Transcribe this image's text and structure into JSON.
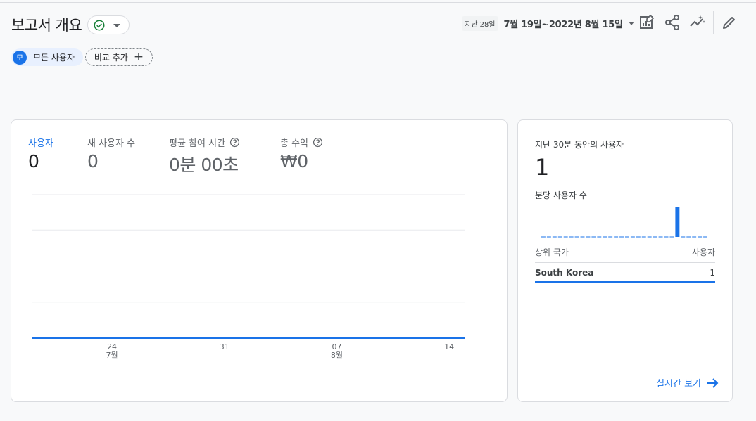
{
  "header": {
    "title": "보고서 개요",
    "status": "check-circle-icon",
    "date_chip": "지난 28일",
    "date_range": "7월 19일~2022년 8월 15일"
  },
  "toolbar": {
    "icons": [
      "customize-report-icon",
      "share-icon",
      "insights-icon",
      "edit-icon"
    ]
  },
  "comparison": {
    "segment_letter": "모",
    "segment_label": "모든 사용자",
    "add_label": "비교 추가"
  },
  "metrics": [
    {
      "label": "사용자",
      "value": "0",
      "active": true
    },
    {
      "label": "새 사용자 수",
      "value": "0"
    },
    {
      "label": "평균 참여 시간",
      "value": "0분 00초",
      "help": true
    },
    {
      "label": "총 수익",
      "value": "₩0",
      "help": true
    }
  ],
  "chart_data": {
    "type": "line",
    "x": [
      "2022-07-19",
      "2022-07-20",
      "2022-07-21",
      "2022-07-22",
      "2022-07-23",
      "2022-07-24",
      "2022-07-25",
      "2022-07-26",
      "2022-07-27",
      "2022-07-28",
      "2022-07-29",
      "2022-07-30",
      "2022-07-31",
      "2022-08-01",
      "2022-08-02",
      "2022-08-03",
      "2022-08-04",
      "2022-08-05",
      "2022-08-06",
      "2022-08-07",
      "2022-08-08",
      "2022-08-09",
      "2022-08-10",
      "2022-08-11",
      "2022-08-12",
      "2022-08-13",
      "2022-08-14",
      "2022-08-15"
    ],
    "series": [
      {
        "values": [
          0,
          0,
          0,
          0,
          0,
          0,
          0,
          0,
          0,
          0,
          0,
          0,
          0,
          0,
          0,
          0,
          0,
          0,
          0,
          0,
          0,
          0,
          0,
          0,
          0,
          0,
          0,
          0
        ]
      }
    ],
    "tick_labels": [
      {
        "x": "2022-07-24",
        "day": "24",
        "month": "7월"
      },
      {
        "x": "2022-07-31",
        "day": "31",
        "month": ""
      },
      {
        "x": "2022-08-07",
        "day": "07",
        "month": "8월"
      },
      {
        "x": "2022-08-14",
        "day": "14",
        "month": ""
      }
    ],
    "grid": true,
    "line_color": "#1a73e8"
  },
  "realtime": {
    "title": "지난 30분 동안의 사용자",
    "value": "1",
    "subtitle": "분당 사용자 수",
    "per_minute": [
      0,
      0,
      0,
      0,
      0,
      0,
      0,
      0,
      0,
      0,
      0,
      0,
      0,
      0,
      0,
      0,
      0,
      0,
      0,
      0,
      0,
      0,
      0,
      0,
      1,
      0,
      0,
      0,
      0,
      0
    ],
    "col_left": "상위 국가",
    "col_right": "사용자",
    "rows": [
      {
        "country": "South Korea",
        "users": "1"
      }
    ],
    "link_label": "실시간 보기"
  }
}
